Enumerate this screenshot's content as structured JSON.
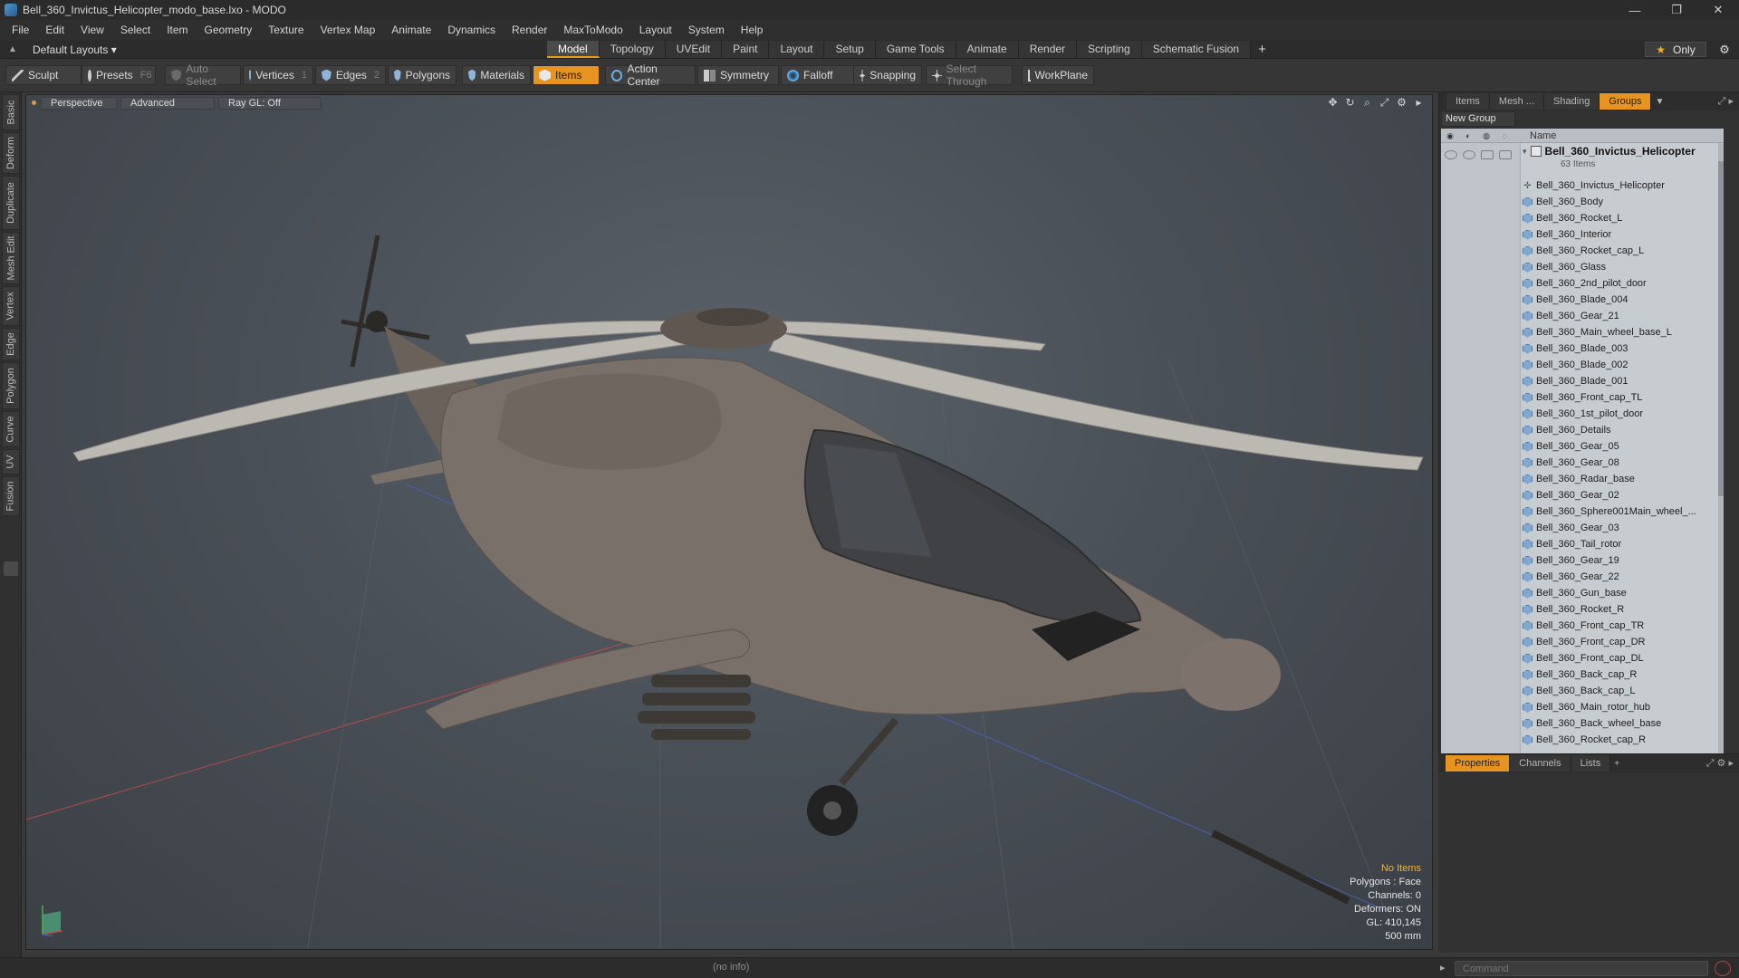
{
  "window": {
    "title": "Bell_360_Invictus_Helicopter_modo_base.lxo - MODO",
    "controls": [
      "—",
      "❐",
      "✕"
    ]
  },
  "menu": [
    "File",
    "Edit",
    "View",
    "Select",
    "Item",
    "Geometry",
    "Texture",
    "Vertex Map",
    "Animate",
    "Dynamics",
    "Render",
    "MaxToModo",
    "Layout",
    "System",
    "Help"
  ],
  "layout_selector": "Default Layouts ▾",
  "main_tabs": {
    "items": [
      "Model",
      "Topology",
      "UVEdit",
      "Paint",
      "Layout",
      "Setup",
      "Game Tools",
      "Animate",
      "Render",
      "Scripting",
      "Schematic Fusion"
    ],
    "active": "Model",
    "add": "+"
  },
  "only_button": "Only",
  "toolbar": {
    "sculpt": "Sculpt",
    "presets": "Presets",
    "presets_key": "F6",
    "auto_select": "Auto Select",
    "vertices": "Vertices",
    "vertices_key": "1",
    "edges": "Edges",
    "edges_key": "2",
    "polygons": "Polygons",
    "materials": "Materials",
    "items": "Items",
    "action_center": "Action Center",
    "symmetry": "Symmetry",
    "falloff": "Falloff",
    "snapping": "Snapping",
    "select_through": "Select Through",
    "workplane": "WorkPlane"
  },
  "left_tabs": [
    "Basic",
    "Deform",
    "Duplicate",
    "Mesh Edit",
    "Vertex",
    "Edge",
    "Polygon",
    "Curve",
    "UV",
    "Fusion"
  ],
  "viewport": {
    "view": "Perspective",
    "shading": "Advanced",
    "raygl": "Ray GL: Off",
    "info": {
      "selection": "No Items",
      "polygons": "Polygons : Face",
      "channels": "Channels: 0",
      "deformers": "Deformers: ON",
      "gl": "GL: 410,145",
      "scale": "500 mm"
    }
  },
  "items_panel": {
    "tabs": [
      "Items",
      "Mesh ...",
      "Shading",
      "Groups"
    ],
    "active_tab": "Groups",
    "new_group": "New Group",
    "column_name": "Name",
    "group_name": "Bell_360_Invictus_Helicopter",
    "group_count": "63 Items",
    "items": [
      "Bell_360_Invictus_Helicopter",
      "Bell_360_Body",
      "Bell_360_Rocket_L",
      "Bell_360_Interior",
      "Bell_360_Rocket_cap_L",
      "Bell_360_Glass",
      "Bell_360_2nd_pilot_door",
      "Bell_360_Blade_004",
      "Bell_360_Gear_21",
      "Bell_360_Main_wheel_base_L",
      "Bell_360_Blade_003",
      "Bell_360_Blade_002",
      "Bell_360_Blade_001",
      "Bell_360_Front_cap_TL",
      "Bell_360_1st_pilot_door",
      "Bell_360_Details",
      "Bell_360_Gear_05",
      "Bell_360_Gear_08",
      "Bell_360_Radar_base",
      "Bell_360_Gear_02",
      "Bell_360_Sphere001Main_wheel_...",
      "Bell_360_Gear_03",
      "Bell_360_Tail_rotor",
      "Bell_360_Gear_19",
      "Bell_360_Gear_22",
      "Bell_360_Gun_base",
      "Bell_360_Rocket_R",
      "Bell_360_Front_cap_TR",
      "Bell_360_Front_cap_DR",
      "Bell_360_Front_cap_DL",
      "Bell_360_Back_cap_R",
      "Bell_360_Back_cap_L",
      "Bell_360_Main_rotor_hub",
      "Bell_360_Back_wheel_base",
      "Bell_360_Rocket_cap_R"
    ]
  },
  "props_panel": {
    "tabs": [
      "Properties",
      "Channels",
      "Lists"
    ],
    "active_tab": "Properties",
    "add": "+"
  },
  "status": {
    "info": "(no info)",
    "command_placeholder": "Command"
  },
  "colors": {
    "accent": "#e6941f",
    "viewport_bg": "#4a5057"
  }
}
